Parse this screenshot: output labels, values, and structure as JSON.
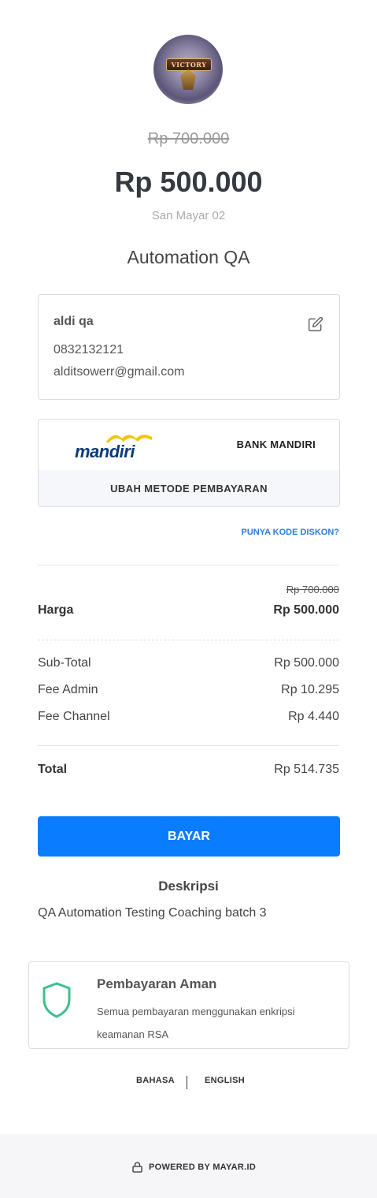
{
  "product": {
    "avatar_text": "VICTORY",
    "old_price": "Rp 700.000",
    "price": "Rp 500.000",
    "seller": "San Mayar 02",
    "name": "Automation QA"
  },
  "buyer": {
    "name": "aldi qa",
    "phone": "0832132121",
    "email": "alditsowerr@gmail.com",
    "edit_icon": "edit-icon"
  },
  "payment": {
    "logo_text": "mandiri",
    "bank_name": "BANK MANDIRI",
    "change_label": "UBAH METODE PEMBAYARAN",
    "discount_link": "PUNYA KODE DISKON?"
  },
  "summary": {
    "harga_old": "Rp 700.000",
    "harga_label": "Harga",
    "harga_value": "Rp 500.000",
    "subtotal_label": "Sub-Total",
    "subtotal_value": "Rp 500.000",
    "fee_admin_label": "Fee Admin",
    "fee_admin_value": "Rp 10.295",
    "fee_channel_label": "Fee Channel",
    "fee_channel_value": "Rp 4.440",
    "total_label": "Total",
    "total_value": "Rp 514.735"
  },
  "actions": {
    "pay_label": "BAYAR"
  },
  "description": {
    "title": "Deskripsi",
    "text": "QA Automation Testing Coaching batch 3"
  },
  "secure": {
    "title": "Pembayaran Aman",
    "text": "Semua pembayaran menggunakan enkripsi keamanan RSA",
    "icon": "shield-icon",
    "color": "#3cc08a"
  },
  "language": {
    "label": "BAHASA",
    "value": "ENGLISH"
  },
  "footer": {
    "powered": "POWERED BY MAYAR.ID",
    "icon": "lock-icon"
  },
  "colors": {
    "primary": "#0a7cff",
    "link": "#2d7bd8"
  }
}
